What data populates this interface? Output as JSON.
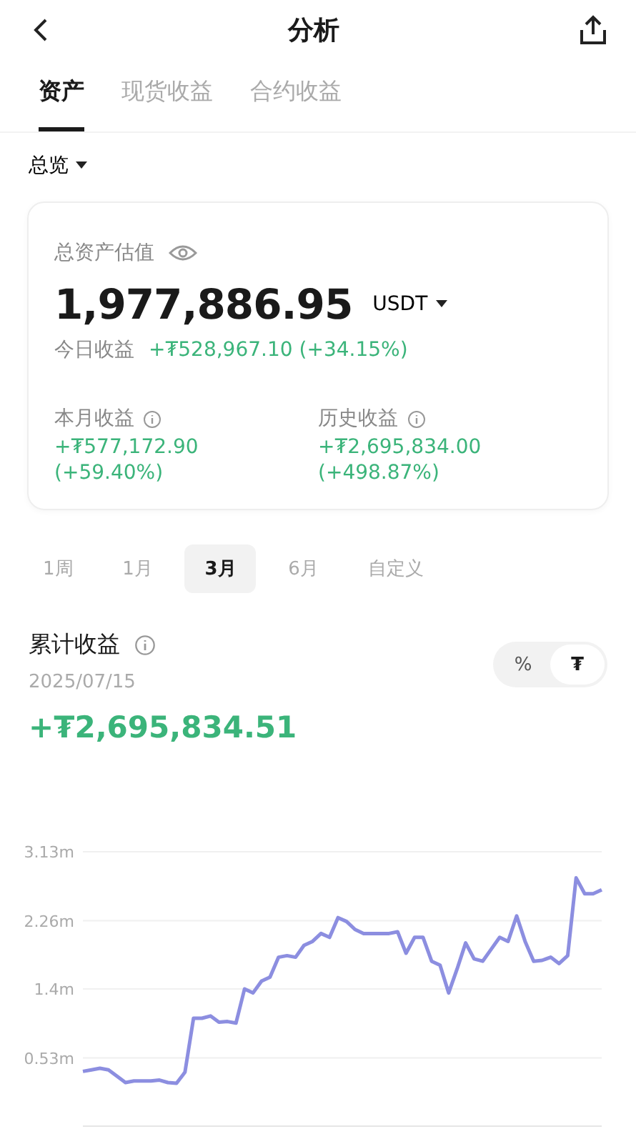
{
  "header": {
    "title": "分析"
  },
  "tabs": [
    {
      "label": "资产",
      "selected": true
    },
    {
      "label": "现货收益",
      "selected": false
    },
    {
      "label": "合约收益",
      "selected": false
    }
  ],
  "filter": {
    "label": "总览"
  },
  "summary": {
    "label": "总资产估值",
    "value": "1,977,886.95",
    "currency": "USDT",
    "today_label": "今日收益",
    "today_value": "+₮528,967.10 (+34.15%)",
    "stats": [
      {
        "label": "本月收益",
        "value": "+₮577,172.90",
        "percent": "(+59.40%)"
      },
      {
        "label": "历史收益",
        "value": "+₮2,695,834.00",
        "percent": "(+498.87%)"
      }
    ]
  },
  "periods": [
    {
      "label": "1周",
      "selected": false
    },
    {
      "label": "1月",
      "selected": false
    },
    {
      "label": "3月",
      "selected": true
    },
    {
      "label": "6月",
      "selected": false
    },
    {
      "label": "自定义",
      "selected": false
    }
  ],
  "cumulative": {
    "title": "累计收益",
    "date": "2025/07/15",
    "value": "+₮2,695,834.51",
    "toggle": [
      {
        "label": "%",
        "selected": false
      },
      {
        "label": "₮",
        "selected": true
      }
    ],
    "chart_data": {
      "type": "line",
      "grid": true,
      "ylim": [
        -0.33,
        3.13
      ],
      "yticks": [
        {
          "value": 0.53,
          "label": "0.53m"
        },
        {
          "value": 1.4,
          "label": "1.4m"
        },
        {
          "value": 2.26,
          "label": "2.26m"
        },
        {
          "value": 3.13,
          "label": "3.13m"
        }
      ],
      "series": [
        {
          "color": "#8c8ee0",
          "values": [
            0.36,
            0.38,
            0.4,
            0.38,
            0.3,
            0.22,
            0.24,
            0.24,
            0.24,
            0.25,
            0.22,
            0.21,
            0.35,
            1.03,
            1.03,
            1.06,
            0.98,
            0.99,
            0.97,
            1.4,
            1.35,
            1.5,
            1.55,
            1.8,
            1.82,
            1.8,
            1.95,
            2.0,
            2.1,
            2.05,
            2.3,
            2.25,
            2.15,
            2.1,
            2.1,
            2.1,
            2.1,
            2.12,
            1.85,
            2.05,
            2.05,
            1.75,
            1.7,
            1.35,
            1.65,
            1.98,
            1.78,
            1.75,
            1.9,
            2.05,
            2.0,
            2.32,
            2.0,
            1.75,
            1.76,
            1.8,
            1.72,
            1.82,
            2.8,
            2.6,
            2.6,
            2.65
          ]
        }
      ]
    }
  }
}
